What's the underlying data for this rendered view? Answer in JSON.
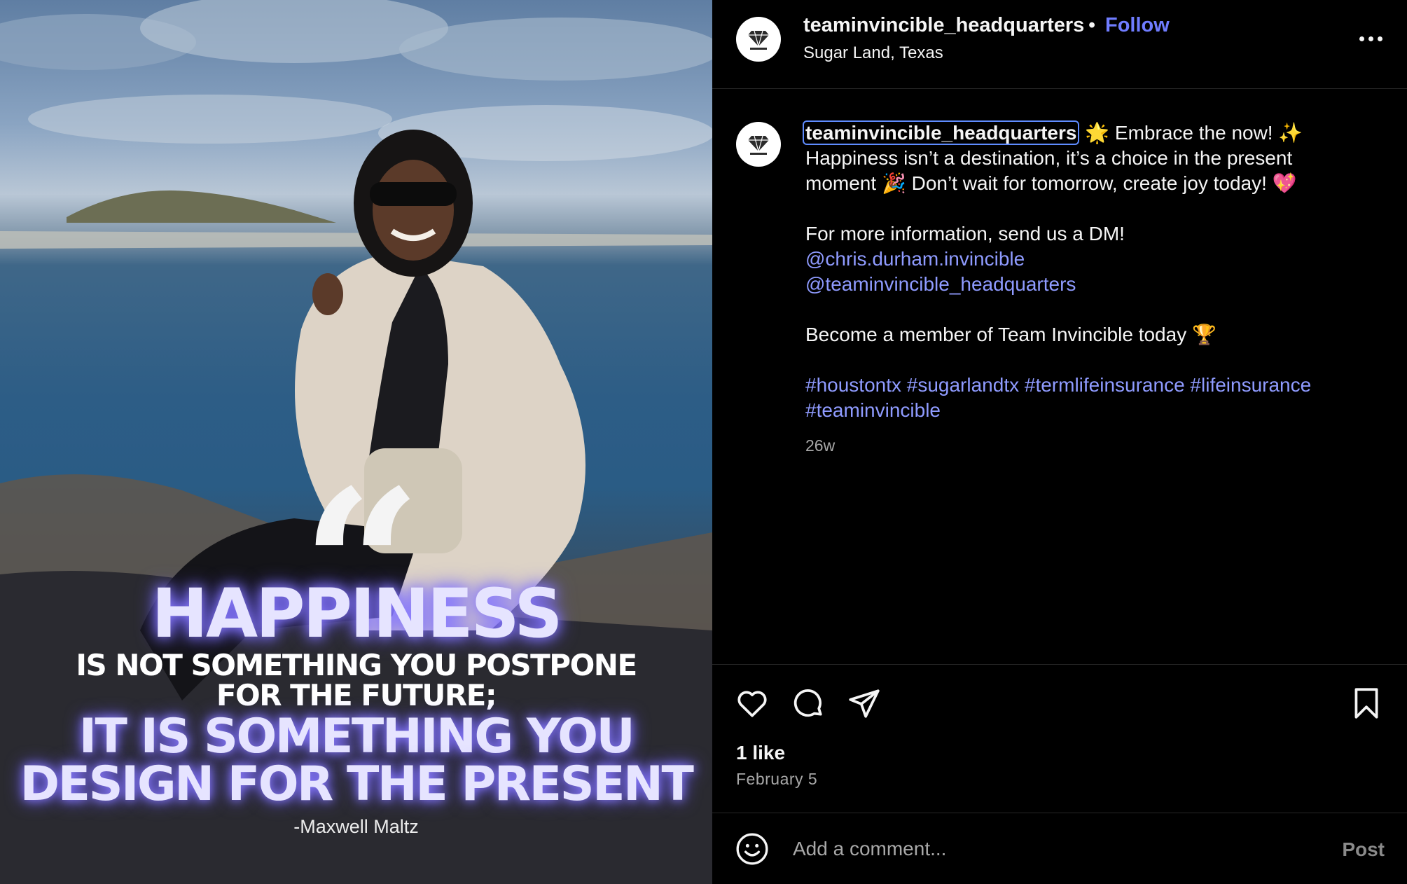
{
  "post": {
    "author": "teaminvincible_headquarters",
    "separator": "•",
    "follow_label": "Follow",
    "location": "Sugar Land, Texas"
  },
  "image": {
    "quote_mark": "“",
    "headline": "HAPPINESS",
    "line1": "IS NOT SOMETHING YOU POSTPONE",
    "line2": "FOR THE FUTURE;",
    "accent1": "IT IS SOMETHING YOU",
    "accent2": "DESIGN FOR THE PRESENT",
    "author": "-Maxwell Maltz",
    "accent_color": "#8c7dff"
  },
  "caption": {
    "username": "teaminvincible_headquarters",
    "line1_emoji_a": "🌟",
    "line1_text": "Embrace the now!",
    "line1_emoji_b": "✨",
    "line2": "Happiness isn’t a destination, it’s a choice in the present",
    "line3_a": "moment",
    "line3_emoji_a": "🎉",
    "line3_b": "Don’t wait for tomorrow, create joy today!",
    "line3_emoji_b": "💖",
    "info": "For more information, send us a DM!",
    "mention1": "@chris.durham.invincible",
    "mention2": "@teaminvincible_headquarters",
    "member": "Become a member of Team Invincible today",
    "member_emoji": "🏆",
    "hashtags_line1": "#houstontx #sugarlandtx #termlifeinsurance #lifeinsurance",
    "hashtags_line2": "#teaminvincible",
    "time_ago": "26w"
  },
  "actions": {
    "likes": "1 like",
    "date": "February 5"
  },
  "comment": {
    "placeholder": "Add a comment...",
    "post_label": "Post"
  },
  "colors": {
    "link": "#8f9bff",
    "follow": "#6f7cff",
    "background": "#000000"
  }
}
